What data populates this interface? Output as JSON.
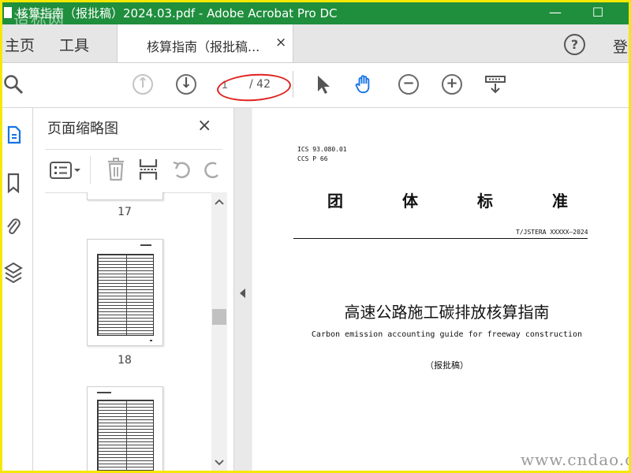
{
  "window": {
    "title": "核算指南（报批稿）2024.03.pdf - Adobe Acrobat Pro DC",
    "watermark": "造标网",
    "min_label": "—",
    "max_label": "☐"
  },
  "tabs": {
    "home": "主页",
    "tools": "工具",
    "document": "核算指南（报批稿...",
    "close": "×",
    "help": "?",
    "login": "登"
  },
  "toolbar": {
    "page_current": "1",
    "page_total": "/ 42"
  },
  "thumbnails": {
    "title": "页面缩略图",
    "close": "×",
    "pages": [
      "17",
      "18"
    ]
  },
  "document": {
    "ics": "ICS 93.080.01",
    "ccs": "CCS P 66",
    "heading_chars": [
      "团",
      "体",
      "标",
      "准"
    ],
    "code": "T/JSTERA XXXXX—2024",
    "title_cn": "高速公路施工碳排放核算指南",
    "title_en": "Carbon emission accounting guide for freeway construction",
    "status": "（报批稿）"
  },
  "site_watermark": "www.cndao.com",
  "colors": {
    "titlebar": "#1f8e3d",
    "frame": "#f5e800",
    "annotation": "#e0201d",
    "accent": "#1473e6"
  }
}
